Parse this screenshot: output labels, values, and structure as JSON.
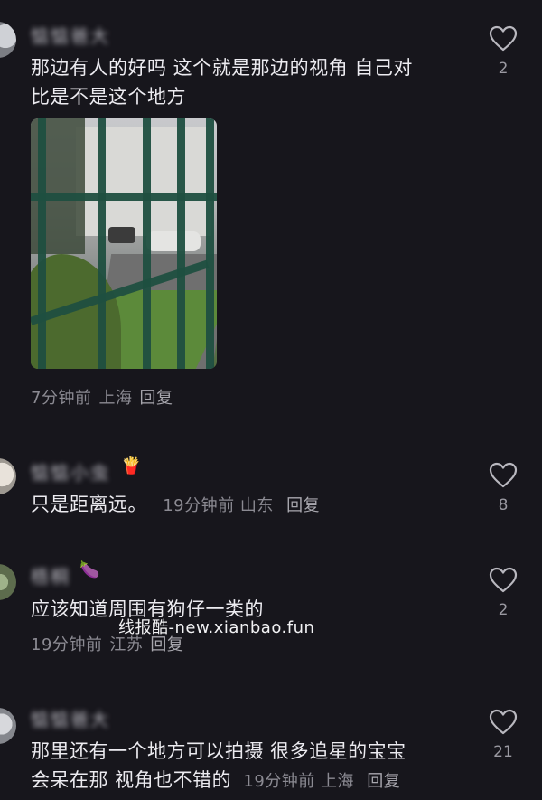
{
  "comments": [
    {
      "username": "惦惦爸大",
      "text_line1": "那边有人的好吗 这个就是那边的视角 自己对",
      "text_line2": "比是不是这个地方",
      "time": "7分钟前",
      "location": "上海",
      "reply": "回复",
      "likes": "2",
      "has_image": true
    },
    {
      "username": "惦惦小虫",
      "badge": "🍟",
      "text": "只是距离远。",
      "time": "19分钟前",
      "location": "山东",
      "reply": "回复",
      "likes": "8"
    },
    {
      "username": "梧桐",
      "badge": "🍆",
      "text": "应该知道周围有狗仔一类的",
      "time": "19分钟前",
      "location": "江苏",
      "reply": "回复",
      "likes": "2"
    },
    {
      "username": "惦惦爸大",
      "text_line1": "那里还有一个地方可以拍摄 很多追星的宝宝",
      "text_line2": "会呆在那 视角也不错的",
      "time": "19分钟前",
      "location": "上海",
      "reply": "回复",
      "likes": "21"
    }
  ],
  "watermark": "线报酷-new.xianbao.fun",
  "icons": {
    "like": "heart-outline-icon"
  },
  "colors": {
    "background": "#17161c",
    "text": "#ecebf0",
    "meta": "#8b8a92"
  }
}
